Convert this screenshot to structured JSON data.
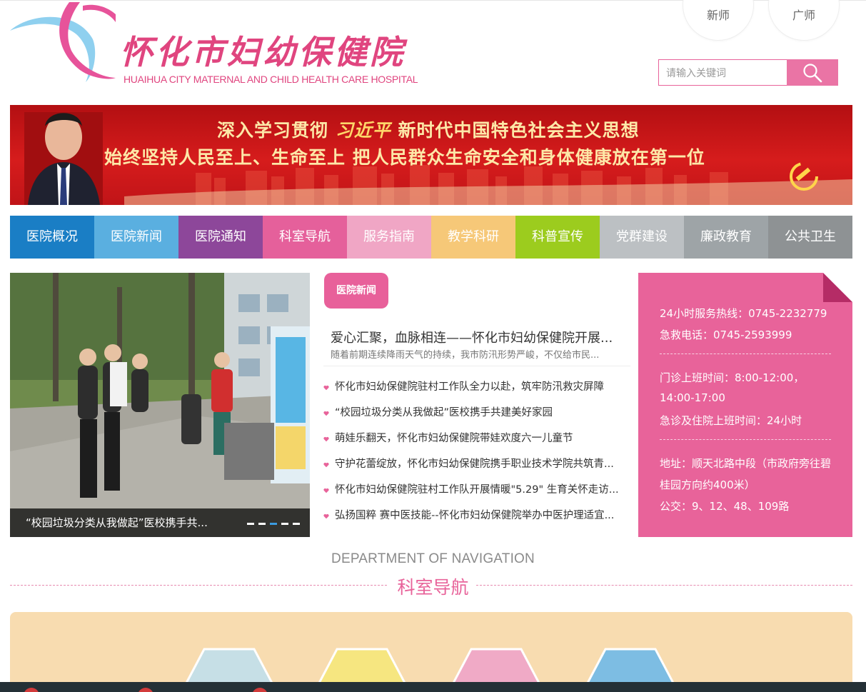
{
  "header": {
    "logo_title": "怀化市妇幼保健院",
    "logo_subtitle": "HUAIHUA CITY MATERNAL AND CHILD HEALTH CARE HOSPITAL",
    "circle_buttons": [
      "新师",
      "广师"
    ],
    "search": {
      "placeholder": "请输入关键词"
    }
  },
  "banner": {
    "line1_prefix": "深入学习贯彻",
    "line1_name": "习近平",
    "line1_suffix": "新时代中国特色社会主义思想",
    "line2": "始终坚持人民至上、生命至上   把人民群众生命安全和身体健康放在第一位"
  },
  "nav": [
    {
      "label": "医院概况",
      "color": "#1a7ec5"
    },
    {
      "label": "医院新闻",
      "color": "#5aafe0"
    },
    {
      "label": "医院通知",
      "color": "#8d479a"
    },
    {
      "label": "科室导航",
      "color": "#e5609b"
    },
    {
      "label": "服务指南",
      "color": "#f0a6c5"
    },
    {
      "label": "教学科研",
      "color": "#f6c878"
    },
    {
      "label": "科普宣传",
      "color": "#9ccc1e"
    },
    {
      "label": "党群建设",
      "color": "#bcc0c3"
    },
    {
      "label": "廉政教育",
      "color": "#9ea4a7"
    },
    {
      "label": "公共卫生",
      "color": "#8e9294"
    }
  ],
  "slider": {
    "caption": "“校园垃圾分类从我做起”医校携手共...",
    "dots": 5,
    "active_dot": 3
  },
  "news": {
    "tag": "医院新闻",
    "headline": "爱心汇聚，血脉相连——怀化市妇幼保健院开展...",
    "summary": "随着前期连续降雨天气的持续，我市防汛形势严峻，不仅给市民...",
    "items": [
      "怀化市妇幼保健院驻村工作队全力以赴，筑牢防汛救灾屏障",
      "“校园垃圾分类从我做起”医校携手共建美好家园",
      "萌娃乐翻天，怀化市妇幼保健院带娃欢度六一儿童节",
      "守护花蕾绽放，怀化市妇幼保健院携手职业技术学院共筑青...",
      "怀化市妇幼保健院驻村工作队开展情暖\"5.29\" 生育关怀走访...",
      "弘扬国粹 赛中医技能--怀化市妇幼保健院举办中医护理适宜..."
    ]
  },
  "info": {
    "hotline": "24小时服务热线：0745-2232779",
    "emergency": "急救电话：0745-2593999",
    "hours_1": "门诊上班时间：8:00-12:00，",
    "hours_2": "14:00-17:00",
    "hours_3": "急诊及住院上班时间：24小时",
    "address_1": "地址：顺天北路中段（市政府旁往碧",
    "address_2": "桂园方向约400米）",
    "bus": "公交：9、12、48、109路"
  },
  "dept": {
    "en": "DEPARTMENT OF NAVIGATION",
    "cn": "科室导航",
    "hex_colors": [
      "#c6dfe6",
      "#f6e680",
      "#f0aac6",
      "#7dbde3"
    ]
  }
}
